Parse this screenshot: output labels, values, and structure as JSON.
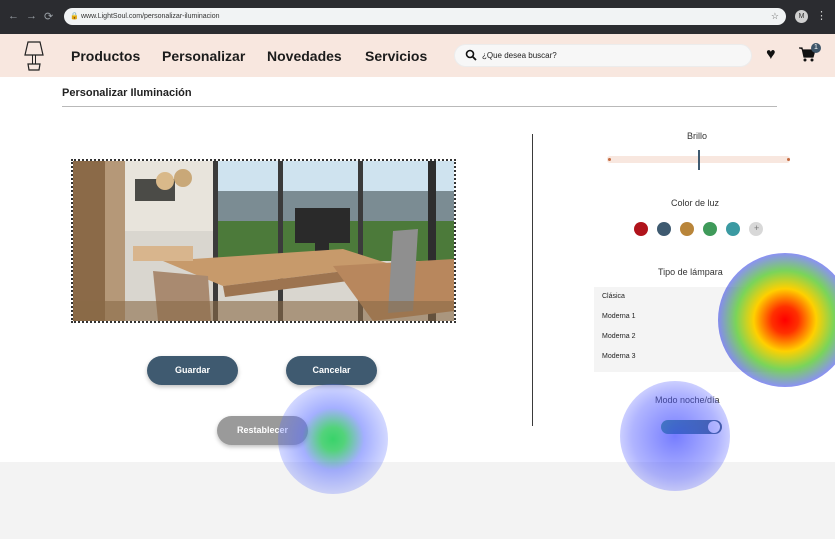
{
  "browser": {
    "url": "www.LightSoul.com/personalizar-iluminacion",
    "profile_initial": "M"
  },
  "header": {
    "nav": [
      "Productos",
      "Personalizar",
      "Novedades",
      "Servicios"
    ],
    "search_placeholder": "¿Que desea buscar?",
    "cart_count": "1"
  },
  "page": {
    "title": "Personalizar Iluminación"
  },
  "buttons": {
    "save": "Guardar",
    "cancel": "Cancelar",
    "reset": "Restablecer"
  },
  "controls": {
    "brightness_label": "Brillo",
    "brightness_value": 0.5,
    "color_label": "Color de luz",
    "colors": [
      "#b0131b",
      "#3e5a70",
      "#b9853a",
      "#3f9a5a",
      "#3b9aa2",
      "#d8d8d8"
    ],
    "lamp_type_label": "Tipo de lámpara",
    "lamp_types": [
      "Clásica",
      "Moderna 1",
      "Moderna 2",
      "Moderna 3"
    ],
    "mode_label": "Modo noche/día"
  }
}
